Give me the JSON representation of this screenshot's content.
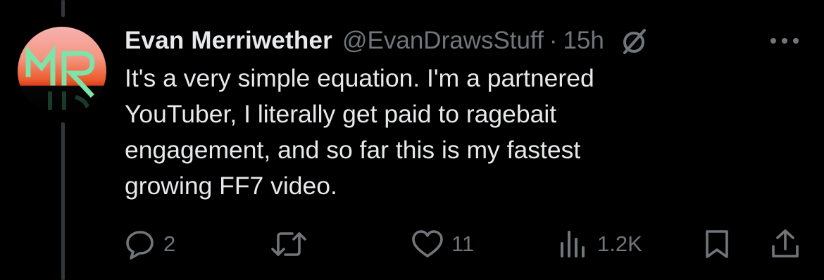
{
  "post": {
    "author": {
      "display_name": "Evan Merriwether",
      "handle": "@EvanDrawsStuff",
      "avatar_initials": "MR"
    },
    "separator": "·",
    "timestamp": "15h",
    "text": "It's a very simple equation. I'm a partnered\nYouTuber, I literally get paid to ragebait\nengagement, and so far this is my fastest\ngrowing FF7 video.",
    "icons": {
      "status": "muted-circle-slash-icon",
      "more": "more-dots-icon"
    },
    "actions": {
      "reply": {
        "icon": "reply-icon",
        "count": "2"
      },
      "retweet": {
        "icon": "retweet-icon",
        "count": ""
      },
      "like": {
        "icon": "heart-icon",
        "count": "11"
      },
      "views": {
        "icon": "views-bars-icon",
        "count": "1.2K"
      },
      "bookmark": {
        "icon": "bookmark-icon"
      },
      "share": {
        "icon": "share-icon"
      }
    }
  },
  "colors": {
    "background": "#000000",
    "text_primary": "#e7e9ea",
    "text_secondary": "#71767b",
    "thread_line": "#333639",
    "avatar_gradient_top": "#f6a8a2",
    "avatar_gradient_bottom": "#e2421e",
    "avatar_letters": "#7be0a6"
  }
}
